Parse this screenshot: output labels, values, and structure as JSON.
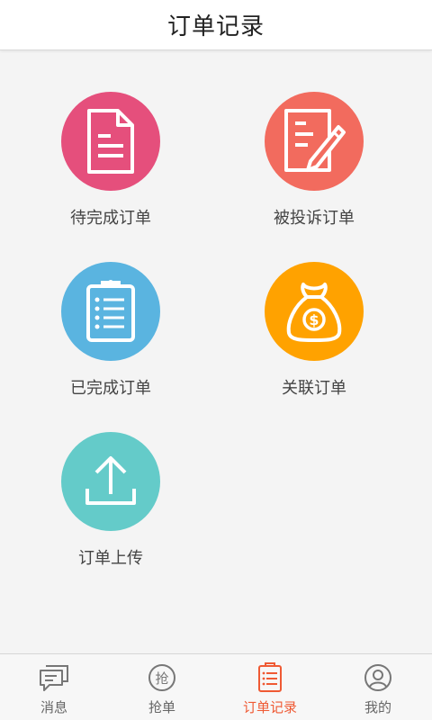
{
  "header": {
    "title": "订单记录"
  },
  "tiles": [
    {
      "label": "待完成订单",
      "icon": "document-icon",
      "color": "#e54f7c"
    },
    {
      "label": "被投诉订单",
      "icon": "edit-document-icon",
      "color": "#f26b5e"
    },
    {
      "label": "已完成订单",
      "icon": "clipboard-list-icon",
      "color": "#5ab4e0"
    },
    {
      "label": "关联订单",
      "icon": "money-bag-icon",
      "color": "#ffa200"
    },
    {
      "label": "订单上传",
      "icon": "upload-icon",
      "color": "#64cbc9"
    }
  ],
  "tabbar": {
    "items": [
      {
        "label": "消息",
        "icon": "chat-icon",
        "active": false
      },
      {
        "label": "抢单",
        "icon": "grab-order-icon",
        "active": false
      },
      {
        "label": "订单记录",
        "icon": "clipboard-icon",
        "active": true
      },
      {
        "label": "我的",
        "icon": "user-icon",
        "active": false
      }
    ],
    "active_color": "#ef5a34",
    "inactive_color": "#666666"
  }
}
